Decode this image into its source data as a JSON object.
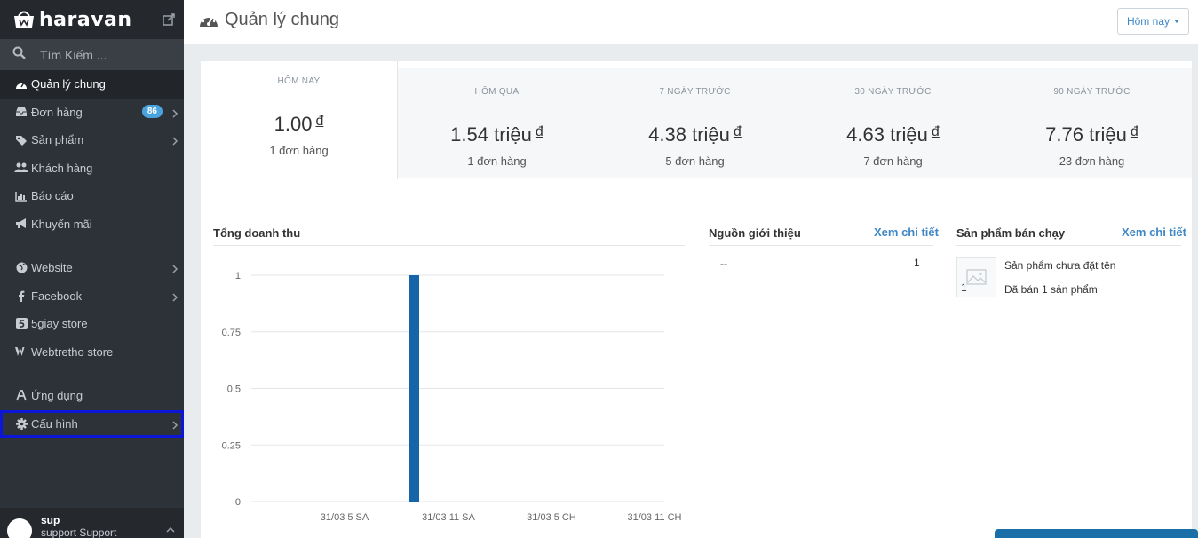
{
  "brand": {
    "name": "haravan"
  },
  "search": {
    "placeholder": "Tìm Kiếm ..."
  },
  "sidebar": {
    "items": [
      {
        "label": "Quản lý chung",
        "icon": "dashboard-icon",
        "active": true
      },
      {
        "label": "Đơn hàng",
        "icon": "inbox-icon",
        "badge": "86",
        "chevron": true
      },
      {
        "label": "Sản phẩm",
        "icon": "tags-icon",
        "chevron": true
      },
      {
        "label": "Khách hàng",
        "icon": "users-icon"
      },
      {
        "label": "Báo cáo",
        "icon": "bar-chart-icon"
      },
      {
        "label": "Khuyến mãi",
        "icon": "bullhorn-icon"
      },
      {
        "label": "Website",
        "icon": "globe-icon",
        "chevron": true
      },
      {
        "label": "Facebook",
        "icon": "facebook-icon",
        "chevron": true
      },
      {
        "label": "5giay store",
        "icon": "5giay-icon"
      },
      {
        "label": "Webtretho store",
        "icon": "webtretho-icon"
      },
      {
        "label": "Ứng dụng",
        "icon": "apps-icon"
      },
      {
        "label": "Cấu hình",
        "icon": "gear-icon",
        "chevron": true,
        "selected": true
      }
    ]
  },
  "user": {
    "name": "sup",
    "subtitle": "support Support"
  },
  "header": {
    "title": "Quản lý chung",
    "period_label": "Hôm nay"
  },
  "stats": [
    {
      "label": "HÔM NAY",
      "amount": "1.00",
      "currency": "đ",
      "orders": "1 đơn hàng",
      "active": true
    },
    {
      "label": "HÔM QUA",
      "amount": "1.54 triệu",
      "currency": "đ",
      "orders": "1 đơn hàng"
    },
    {
      "label": "7 NGÀY TRƯỚC",
      "amount": "4.38 triệu",
      "currency": "đ",
      "orders": "5 đơn hàng"
    },
    {
      "label": "30 NGÀY TRƯỚC",
      "amount": "4.63 triệu",
      "currency": "đ",
      "orders": "7 đơn hàng"
    },
    {
      "label": "90 NGÀY TRƯỚC",
      "amount": "7.76 triệu",
      "currency": "đ",
      "orders": "23 đơn hàng"
    }
  ],
  "revenue": {
    "title": "Tổng doanh thu"
  },
  "referrals": {
    "title": "Nguồn giới thiệu",
    "link": "Xem chi tiết",
    "rows": [
      {
        "source": "--",
        "count": "1"
      }
    ]
  },
  "bestsellers": {
    "title": "Sản phẩm bán chạy",
    "link": "Xem chi tiết",
    "items": [
      {
        "qty": "1",
        "name": "Sản phẩm chưa đặt tên",
        "sold": "Đã bán 1 sản phẩm",
        "thumb_icon": "image-placeholder-icon"
      }
    ]
  },
  "colors": {
    "sidebar_bg": "#2d3238",
    "accent": "#3f87c6",
    "bar": "#1565a8",
    "badge": "#4aa3df",
    "selection": "#0b16d8"
  },
  "chart_data": {
    "type": "bar",
    "categories": [
      "31/03 5 SA",
      "31/03 11 SA",
      "31/03 5 CH",
      "31/03 11 CH"
    ],
    "x_ticks": [
      "31/03 5 SA",
      "31/03 11 SA",
      "31/03 5 CH",
      "31/03 11 CH"
    ],
    "y_ticks": [
      "0",
      "0.25",
      "0.5",
      "0.75",
      "1"
    ],
    "series": [
      {
        "values": [
          0,
          1,
          0,
          0
        ]
      }
    ],
    "ylim": [
      0,
      1
    ],
    "grid": true
  }
}
